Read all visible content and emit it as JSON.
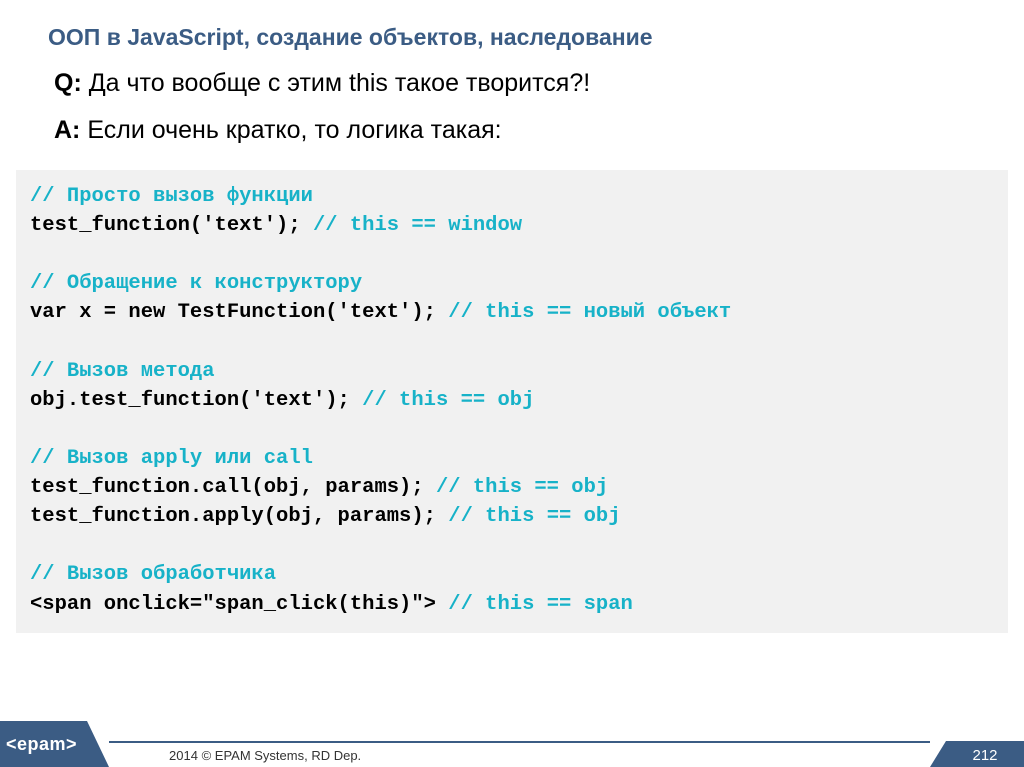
{
  "title": "ООП в JavaScript, создание объектов, наследование",
  "q_prefix": "Q:",
  "q_text": " Да что вообще с этим this такое творится?!",
  "a_prefix": "A:",
  "a_text": " Если очень кратко, то логика такая:",
  "code": {
    "l1_cmt": "// Просто вызов функции",
    "l2_code": "test_function('text'); ",
    "l2_cmt": "// this == window",
    "l4_cmt": "// Обращение к конструктору",
    "l5_code": "var x = new TestFunction('text'); ",
    "l5_cmt": "// this == новый объект",
    "l7_cmt": "// Вызов метода",
    "l8_code": "obj.test_function('text'); ",
    "l8_cmt": "// this == obj",
    "l10_cmt": "// Вызов apply или call",
    "l11_code": "test_function.call(obj, params); ",
    "l11_cmt": "// this == obj",
    "l12_code": "test_function.apply(obj, params); ",
    "l12_cmt": "// this == obj",
    "l14_cmt": "// Вызов обработчика",
    "l15_code": "<span onclick=\"span_click(this)\"> ",
    "l15_cmt": "// this == span"
  },
  "footer": {
    "logo": "<epam>",
    "copyright": "2014 © EPAM Systems, RD Dep.",
    "page": "212"
  }
}
